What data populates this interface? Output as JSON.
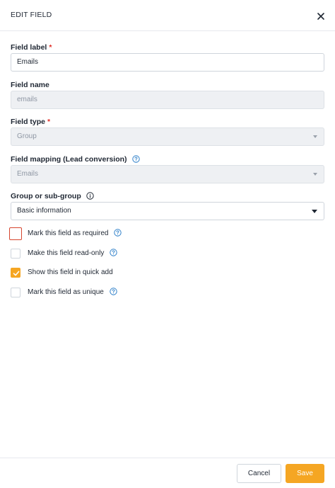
{
  "header": {
    "title": "EDIT FIELD",
    "close_icon": "close-icon"
  },
  "fields": {
    "field_label": {
      "label": "Field label",
      "required_mark": "*",
      "value": "Emails"
    },
    "field_name": {
      "label": "Field name",
      "value": "emails"
    },
    "field_type": {
      "label": "Field type",
      "required_mark": "*",
      "value": "Group"
    },
    "field_mapping": {
      "label": "Field mapping (Lead conversion)",
      "value": "Emails",
      "help_icon": "help-circle-icon"
    },
    "group": {
      "label": "Group or sub-group",
      "value": "Basic information",
      "info_icon": "info-circle-icon"
    }
  },
  "checkboxes": [
    {
      "label": "Mark this field as required",
      "checked": false,
      "help": true
    },
    {
      "label": "Make this field read-only",
      "checked": false,
      "help": true
    },
    {
      "label": "Show this field in quick add",
      "checked": true,
      "help": false
    },
    {
      "label": "Mark this field as unique",
      "checked": false,
      "help": true
    }
  ],
  "footer": {
    "cancel_label": "Cancel",
    "save_label": "Save"
  },
  "colors": {
    "accent": "#f5a623",
    "required": "#e0312a",
    "help": "#2f80c9",
    "focus_border": "#d6452e"
  }
}
